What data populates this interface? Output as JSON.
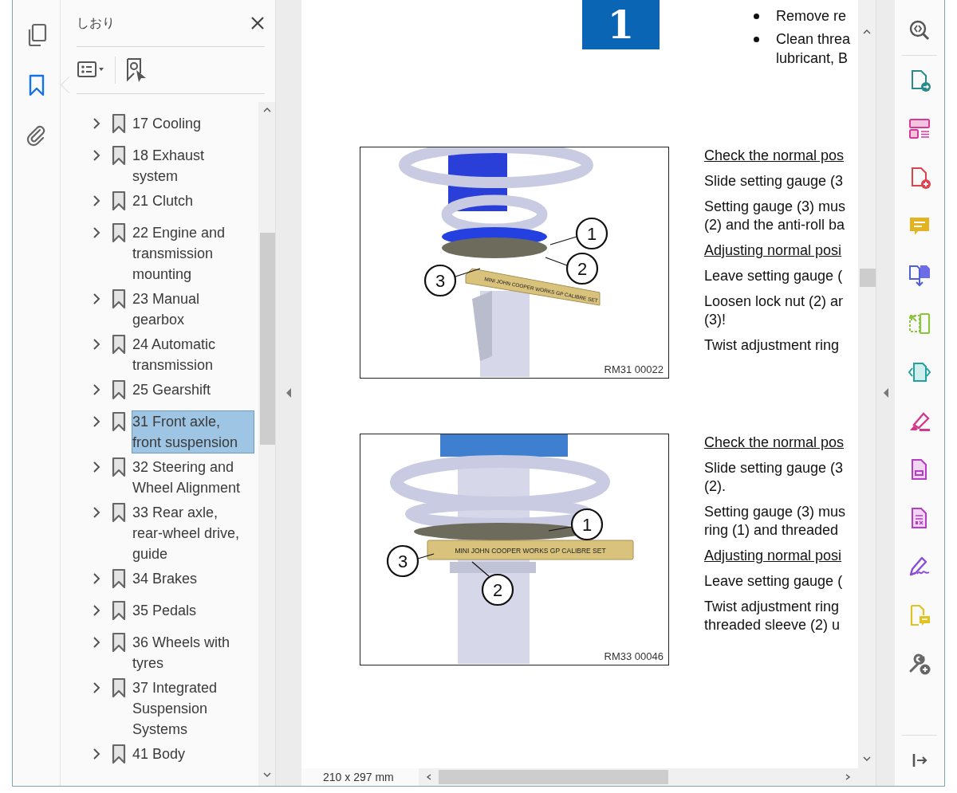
{
  "left_rail": {
    "tools": [
      {
        "kind": "pages",
        "selected": false
      },
      {
        "kind": "bookmarks",
        "selected": true
      },
      {
        "kind": "attachments",
        "selected": false
      }
    ]
  },
  "bookmarks_panel": {
    "title": "しおり",
    "items": [
      {
        "lines": [
          "17 Cooling"
        ],
        "selected": false,
        "expanded": false
      },
      {
        "lines": [
          "18 Exhaust",
          "system"
        ],
        "selected": false,
        "expanded": false
      },
      {
        "lines": [
          "21 Clutch"
        ],
        "selected": false,
        "expanded": false
      },
      {
        "lines": [
          "22 Engine and",
          "transmission",
          "mounting"
        ],
        "selected": false,
        "expanded": false
      },
      {
        "lines": [
          "23 Manual",
          "gearbox"
        ],
        "selected": false,
        "expanded": false
      },
      {
        "lines": [
          "24 Automatic",
          "transmission"
        ],
        "selected": false,
        "expanded": false
      },
      {
        "lines": [
          "25 Gearshift"
        ],
        "selected": false,
        "expanded": false
      },
      {
        "lines": [
          "31 Front axle,",
          "front suspension"
        ],
        "selected": true,
        "expanded": false
      },
      {
        "lines": [
          "32 Steering and",
          "Wheel Alignment"
        ],
        "selected": false,
        "expanded": false
      },
      {
        "lines": [
          "33 Rear axle,",
          "rear-wheel drive,",
          "guide"
        ],
        "selected": false,
        "expanded": false
      },
      {
        "lines": [
          "34 Brakes"
        ],
        "selected": false,
        "expanded": false
      },
      {
        "lines": [
          "35 Pedals"
        ],
        "selected": false,
        "expanded": false
      },
      {
        "lines": [
          "36 Wheels with",
          "tyres"
        ],
        "selected": false,
        "expanded": false
      },
      {
        "lines": [
          "37 Integrated",
          "Suspension",
          "Systems"
        ],
        "selected": false,
        "expanded": false
      },
      {
        "lines": [
          "41 Body"
        ],
        "selected": false,
        "expanded": false
      }
    ]
  },
  "document": {
    "chapter_badge": "1",
    "bullets": [
      {
        "lines": [
          "Remove re"
        ]
      },
      {
        "lines": [
          "Clean threa",
          "lubricant, B"
        ]
      }
    ],
    "sections": [
      {
        "figure": {
          "kind": "angled",
          "callouts": [
            "1",
            "2",
            "3"
          ],
          "gauge_label": "MINI JOHN COOPER WORKS GP CALIBRE SET",
          "code": "RM31 00022"
        },
        "text": [
          {
            "kind": "heading",
            "lines": [
              "Check the normal pos"
            ]
          },
          {
            "kind": "para",
            "lines": [
              "Slide setting gauge (3"
            ]
          },
          {
            "kind": "para",
            "lines": [
              "Setting gauge (3) mus",
              "(2) and the anti-roll ba"
            ]
          },
          {
            "kind": "heading",
            "lines": [
              "Adjusting normal posi"
            ]
          },
          {
            "kind": "para",
            "lines": [
              "Leave setting gauge ("
            ]
          },
          {
            "kind": "para",
            "lines": [
              "Loosen lock nut (2) ar",
              "(3)!"
            ]
          },
          {
            "kind": "para",
            "lines": [
              "Twist adjustment ring"
            ]
          }
        ]
      },
      {
        "figure": {
          "kind": "level",
          "callouts": [
            "1",
            "2",
            "3"
          ],
          "gauge_label": "MINI JOHN COOPER WORKS GP CALIBRE SET",
          "code": "RM33 00046"
        },
        "text": [
          {
            "kind": "heading",
            "lines": [
              "Check the normal pos"
            ]
          },
          {
            "kind": "para",
            "lines": [
              "Slide setting gauge (3",
              "(2)."
            ]
          },
          {
            "kind": "para",
            "lines": [
              "Setting gauge (3) mus",
              "ring (1) and threaded"
            ]
          },
          {
            "kind": "heading",
            "lines": [
              "Adjusting normal posi"
            ]
          },
          {
            "kind": "para",
            "lines": [
              "Leave setting gauge ("
            ]
          },
          {
            "kind": "para",
            "lines": [
              "Twist adjustment ring",
              "threaded sleeve (2) u"
            ]
          }
        ]
      }
    ],
    "page_size": "210 x 297 mm"
  },
  "right_tools": [
    {
      "kind": "zoom"
    },
    {
      "kind": "export"
    },
    {
      "kind": "organize"
    },
    {
      "kind": "create"
    },
    {
      "kind": "comment"
    },
    {
      "kind": "combine"
    },
    {
      "kind": "compress"
    },
    {
      "kind": "protect"
    },
    {
      "kind": "highlight"
    },
    {
      "kind": "save"
    },
    {
      "kind": "redact"
    },
    {
      "kind": "sign"
    },
    {
      "kind": "send"
    },
    {
      "kind": "more"
    }
  ],
  "collapse_tool": {
    "kind": "collapse"
  }
}
